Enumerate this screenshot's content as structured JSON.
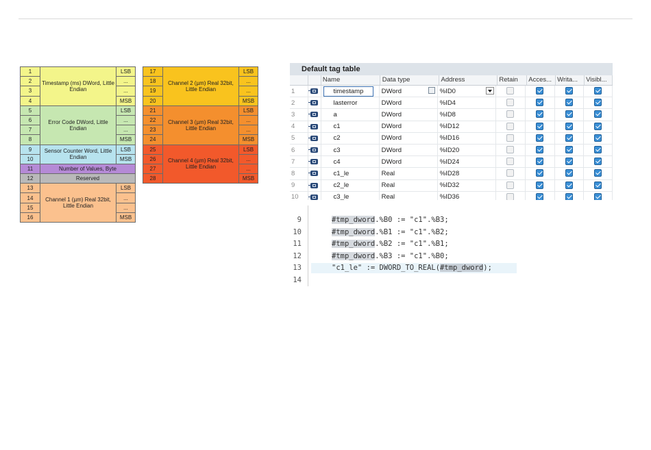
{
  "register_map": {
    "left": [
      {
        "num": "1",
        "flag": "LSB"
      },
      {
        "num": "2",
        "flag": "..."
      },
      {
        "num": "3",
        "flag": "..."
      },
      {
        "num": "4",
        "flag": "MSB"
      },
      {
        "num": "5",
        "flag": "LSB"
      },
      {
        "num": "6",
        "flag": "..."
      },
      {
        "num": "7",
        "flag": "..."
      },
      {
        "num": "8",
        "flag": "MSB"
      },
      {
        "num": "9",
        "flag": "LSB"
      },
      {
        "num": "10",
        "flag": "MSB"
      },
      {
        "num": "11",
        "flag": ""
      },
      {
        "num": "12",
        "flag": ""
      },
      {
        "num": "13",
        "flag": "LSB"
      },
      {
        "num": "14",
        "flag": "..."
      },
      {
        "num": "15",
        "flag": "..."
      },
      {
        "num": "16",
        "flag": "MSB"
      }
    ],
    "left_groups": [
      {
        "label": "Timestamp (ms) DWord, Little Endian",
        "color": "#f3f58a"
      },
      {
        "label": "Error Code DWord, Little Endian",
        "color": "#c6e7b1"
      },
      {
        "label": "Sensor Counter Word, Little Endian",
        "color": "#b7e3ee"
      },
      {
        "label": "Number of Values, Byte",
        "color": "#b58ad6"
      },
      {
        "label": "Reserved",
        "color": "#b9b9b9"
      },
      {
        "label": "Channel 1 (µm) Real 32bit, Little Endian",
        "color": "#fbc18e"
      }
    ],
    "right": [
      {
        "num": "17",
        "flag": "LSB"
      },
      {
        "num": "18",
        "flag": "..."
      },
      {
        "num": "19",
        "flag": "..."
      },
      {
        "num": "20",
        "flag": "MSB"
      },
      {
        "num": "21",
        "flag": "LSB"
      },
      {
        "num": "22",
        "flag": "..."
      },
      {
        "num": "23",
        "flag": "..."
      },
      {
        "num": "24",
        "flag": "MSB"
      },
      {
        "num": "25",
        "flag": "LSB"
      },
      {
        "num": "26",
        "flag": "..."
      },
      {
        "num": "27",
        "flag": "..."
      },
      {
        "num": "28",
        "flag": "MSB"
      }
    ],
    "right_groups": [
      {
        "label": "Channel 2 (µm) Real 32bit, Little Endian",
        "color": "#f9c31e"
      },
      {
        "label": "Channel 3 (µm) Real 32bit, Little Endian",
        "color": "#f48f2e"
      },
      {
        "label": "Channel 4 (µm) Real 32bit, Little Endian",
        "color": "#f2592b"
      }
    ]
  },
  "tag_table": {
    "title": "Default tag table",
    "headers": {
      "name": "Name",
      "type": "Data type",
      "addr": "Address",
      "retain": "Retain",
      "access": "Acces...",
      "write": "Writa...",
      "visible": "Visibl..."
    },
    "rows": [
      {
        "num": "1",
        "name": "timestamp",
        "type": "DWord",
        "addr": "%ID0"
      },
      {
        "num": "2",
        "name": "lasterror",
        "type": "DWord",
        "addr": "%ID4"
      },
      {
        "num": "3",
        "name": "a",
        "type": "DWord",
        "addr": "%ID8"
      },
      {
        "num": "4",
        "name": "c1",
        "type": "DWord",
        "addr": "%ID12"
      },
      {
        "num": "5",
        "name": "c2",
        "type": "DWord",
        "addr": "%ID16"
      },
      {
        "num": "6",
        "name": "c3",
        "type": "DWord",
        "addr": "%ID20"
      },
      {
        "num": "7",
        "name": "c4",
        "type": "DWord",
        "addr": "%ID24"
      },
      {
        "num": "8",
        "name": "c1_le",
        "type": "Real",
        "addr": "%ID28"
      },
      {
        "num": "9",
        "name": "c2_le",
        "type": "Real",
        "addr": "%ID32"
      },
      {
        "num": "10",
        "name": "c3_le",
        "type": "Real",
        "addr": "%ID36"
      }
    ]
  },
  "editor": {
    "lines": [
      {
        "num": "9",
        "var": "#tmp_dword",
        "rest": ".%B0 := \"c1\".%B3;"
      },
      {
        "num": "10",
        "var": "#tmp_dword",
        "rest": ".%B1 := \"c1\".%B2;"
      },
      {
        "num": "11",
        "var": "#tmp_dword",
        "rest": ".%B2 := \"c1\".%B1;"
      },
      {
        "num": "12",
        "var": "#tmp_dword",
        "rest": ".%B3 := \"c1\".%B0;"
      },
      {
        "num": "13",
        "pre": "\"c1_le\" := DWORD_TO_REAL(",
        "var": "#tmp_dword",
        "rest": ");"
      },
      {
        "num": "14",
        "var": "",
        "rest": ""
      }
    ]
  }
}
